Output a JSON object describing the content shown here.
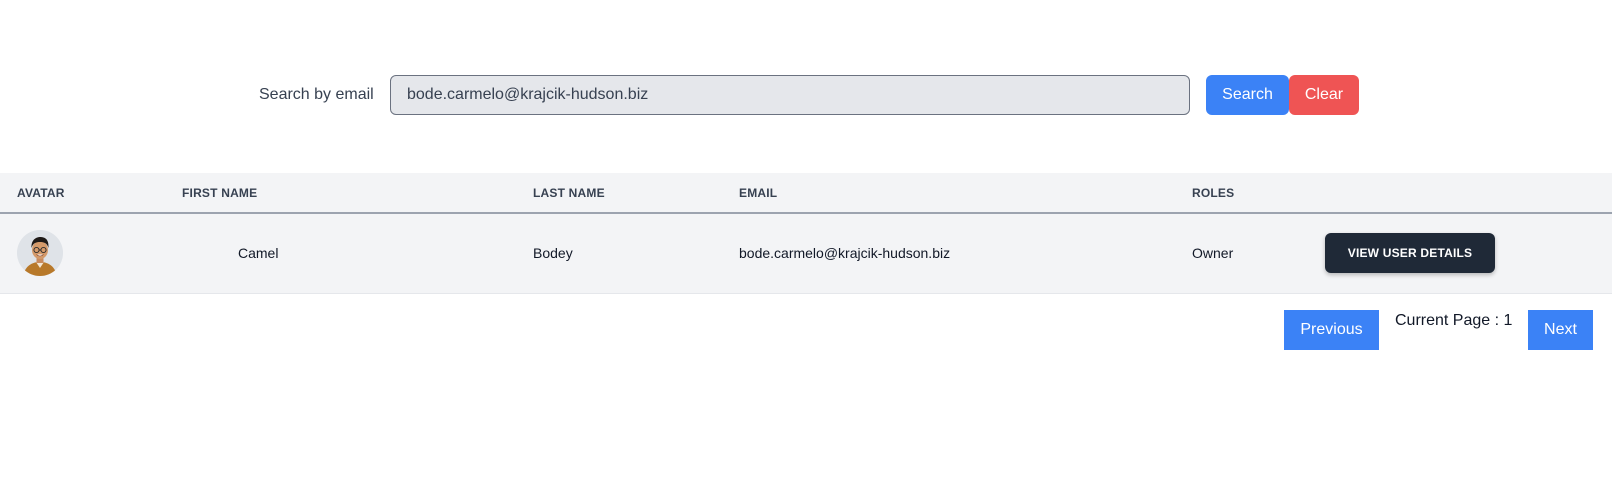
{
  "search": {
    "label": "Search by email",
    "value": "bode.carmelo@krajcik-hudson.biz",
    "search_button": "Search",
    "clear_button": "Clear"
  },
  "table": {
    "columns": [
      "AVATAR",
      "FIRST NAME",
      "LAST NAME",
      "EMAIL",
      "ROLES",
      ""
    ],
    "rows": [
      {
        "avatar": "user-avatar-photo",
        "first_name": "Camel",
        "last_name": "Bodey",
        "email": "bode.carmelo@krajcik-hudson.biz",
        "roles": "Owner",
        "action": "VIEW USER DETAILS"
      }
    ]
  },
  "pagination": {
    "previous": "Previous",
    "current_page_label": "Current Page : 1",
    "next": "Next"
  },
  "colors": {
    "primary": "#3b82f6",
    "danger": "#ef5454",
    "dark": "#1f2937",
    "header_bg": "#f3f4f6"
  }
}
